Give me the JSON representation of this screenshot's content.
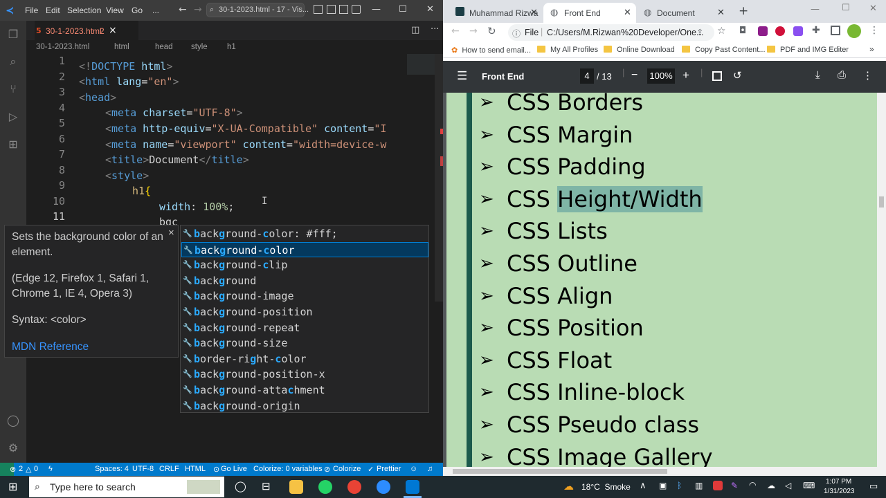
{
  "vscode": {
    "menu": [
      "File",
      "Edit",
      "Selection",
      "View",
      "Go",
      "..."
    ],
    "search_text": "30-1-2023.html - 17 - Vis...",
    "tab_label": "30-1-2023.html",
    "tab_badge": "2",
    "breadcrumb": [
      "30-1-2023.html",
      "html",
      "head",
      "style",
      "h1"
    ],
    "lines": [
      {
        "n": "1"
      },
      {
        "n": "2"
      },
      {
        "n": "3"
      },
      {
        "n": "4"
      },
      {
        "n": "5"
      },
      {
        "n": "6"
      },
      {
        "n": "7"
      },
      {
        "n": "8"
      },
      {
        "n": "9"
      },
      {
        "n": "10"
      },
      {
        "n": "11"
      }
    ],
    "code": {
      "l1a": "<!",
      "l1b": "DOCTYPE",
      "l1c": " html",
      "l2a": "<",
      "l2b": "html",
      "l2c": " lang",
      "l2d": "=",
      "l2e": "\"en\"",
      "l2f": ">",
      "l3a": "<",
      "l3b": "head",
      "l3c": ">",
      "l4a": "<",
      "l4b": "meta",
      "l4c": " charset",
      "l4d": "=",
      "l4e": "\"UTF-8\"",
      "l4f": ">",
      "l5a": "<",
      "l5b": "meta",
      "l5c": " http-equiv",
      "l5d": "=",
      "l5e": "\"X-UA-Compatible\"",
      "l5f": " content",
      "l5g": "=",
      "l5h": "\"I",
      "l6a": "<",
      "l6b": "meta",
      "l6c": " name",
      "l6d": "=",
      "l6e": "\"viewport\"",
      "l6f": " content",
      "l6g": "=",
      "l6h": "\"width=device-w",
      "l7a": "<",
      "l7b": "title",
      "l7c": ">",
      "l7d": "Document",
      "l7e": "</",
      "l7f": "title",
      "l7g": ">",
      "l8a": "<",
      "l8b": "style",
      "l8c": ">",
      "l9a": "h1",
      "l9b": "{",
      "l10a": "width",
      "l10b": ": ",
      "l10c": "100%",
      "l10d": ";",
      "l11a": "bgc"
    },
    "hover": {
      "desc": "Sets the background color of an element.",
      "compat": "(Edge 12, Firefox 1, Safari 1, Chrome 1, IE 4, Opera 3)",
      "syntax": "Syntax: <color>",
      "link": "MDN Reference",
      "close": "×"
    },
    "suggestions": [
      "background-color: #fff;",
      "background-color",
      "background-clip",
      "background",
      "background-image",
      "background-position",
      "background-repeat",
      "background-size",
      "border-right-color",
      "background-position-x",
      "background-attachment",
      "background-origin"
    ],
    "status": {
      "errors": "2",
      "warnings": "0",
      "spaces": "Spaces: 4",
      "encoding": "UTF-8",
      "eol": "CRLF",
      "lang": "HTML",
      "golive": "Go Live",
      "colorize": "Colorize: 0 variables",
      "colorize2": "Colorize",
      "prettier": "Prettier"
    }
  },
  "chrome": {
    "tabs": [
      "Muhammad Rizwa",
      "Front End",
      "Document"
    ],
    "url_prefix": "File",
    "url": "C:/Users/M.Rizwan%20Developer/One...",
    "bookmarks": [
      "How to send email...",
      "My All Profiles",
      "Online Download",
      "Copy Past Content...",
      "PDF and IMG Editer"
    ],
    "pdf_title": "Front End",
    "page_current": "4",
    "page_total": "/ 13",
    "zoom": "100%",
    "items": [
      {
        "pre": "CSS ",
        "hl": "",
        "text": "Borders"
      },
      {
        "pre": "CSS ",
        "hl": "",
        "text": "Margin"
      },
      {
        "pre": "CSS ",
        "hl": "",
        "text": "Padding"
      },
      {
        "pre": "CSS ",
        "hl": "Height/Width",
        "text": ""
      },
      {
        "pre": "CSS ",
        "hl": "",
        "text": "Lists"
      },
      {
        "pre": "CSS ",
        "hl": "",
        "text": "Outline"
      },
      {
        "pre": "CSS ",
        "hl": "",
        "text": "Align"
      },
      {
        "pre": "CSS ",
        "hl": "",
        "text": "Position"
      },
      {
        "pre": "CSS ",
        "hl": "",
        "text": "Float"
      },
      {
        "pre": "CSS ",
        "hl": "",
        "text": "Inline-block"
      },
      {
        "pre": "CSS ",
        "hl": "",
        "text": "Pseudo class"
      },
      {
        "pre": "CSS ",
        "hl": "",
        "text": "Image Gallery"
      }
    ],
    "bullet": "➢"
  },
  "taskbar": {
    "search": "Type here to search",
    "weather": "18°C  Smoke",
    "time": "1:07 PM",
    "date": "1/31/2023"
  }
}
